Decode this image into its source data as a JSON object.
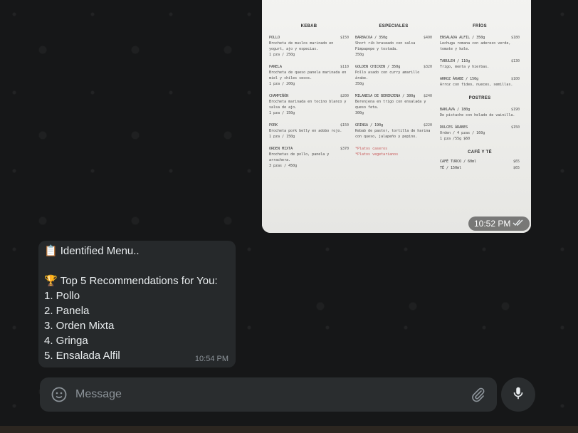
{
  "menu_image": {
    "columns": [
      {
        "title": "KEBAB",
        "items": [
          {
            "name": "POLLO",
            "price": "$150",
            "desc": "Brocheta de muslos marinado en yogurt, ajo y especias.",
            "weight": "1 pza / 250g"
          },
          {
            "name": "PANELA",
            "price": "$110",
            "desc": "Brocheta de queso panela marinada en miel y chiles secos.",
            "weight": "1 pza / 200g"
          },
          {
            "name": "CHAMPIÑÓN",
            "price": "$200",
            "desc": "Brocheta marinada en tocino blanco y salsa de ajo.",
            "weight": "1 pza / 150g"
          },
          {
            "name": "PORK",
            "price": "$150",
            "desc": "Brocheta pork belly en adobo rojo.",
            "weight": "1 pza / 150g"
          },
          {
            "name": "ORDEN MIXTA",
            "price": "$370",
            "desc": "Brochetas de pollo, panela y arrachera.",
            "weight": "3 pzas / 450g"
          }
        ]
      },
      {
        "title": "ESPECIALES",
        "items": [
          {
            "name": "BARBACOA / 350g",
            "price": "$490",
            "desc": "Short rib braseado con salsa Pimpapepe y tostada.",
            "weight": "350g"
          },
          {
            "name": "GOLDEN CHICKEN / 350g",
            "price": "$320",
            "desc": "Pollo asado con curry amarillo árabe.",
            "weight": "350g"
          },
          {
            "name": "MILANESA DE BERENJENA / 300g",
            "price": "$240",
            "desc": "Berenjena en trigo con ensalada y queso feta.",
            "weight": "300g"
          },
          {
            "name": "GRINGA / 190g",
            "price": "$220",
            "desc": "Kebab de pastor, tortilla de harina con queso, jalapeño y pepino.",
            "weight": ""
          }
        ],
        "notes": [
          "*Platos caseros",
          "*Platos vegetarianos"
        ]
      },
      {
        "title": "FRÍOS",
        "items": [
          {
            "name": "ENSALADA ALFIL / 350g",
            "price": "$180",
            "desc": "Lechuga romana con aderezo verde, tomate y kale.",
            "weight": ""
          },
          {
            "name": "TABULEH / 110g",
            "price": "$130",
            "desc": "Trigo, menta y hierbas.",
            "weight": ""
          },
          {
            "name": "ARROZ ÁRABE / 150g",
            "price": "$100",
            "desc": "Arroz con fideo, nueces, semillas.",
            "weight": ""
          }
        ]
      },
      {
        "title": "POSTRES",
        "items": [
          {
            "name": "BAKLAVA / 180g",
            "price": "$190",
            "desc": "De pistache con helado de vainilla.",
            "weight": ""
          },
          {
            "name": "DULCES ÁRABES",
            "price": "$150",
            "desc": "Orden / 4 pzas / 160g",
            "weight": "1 pza /55g  $60"
          }
        ]
      },
      {
        "title": "CAFÉ Y TÉ",
        "items": [
          {
            "name": "CAFÉ TURCO / 60ml",
            "price": "$65",
            "desc": "",
            "weight": ""
          },
          {
            "name": "TÉ / 150ml",
            "price": "$65",
            "desc": "",
            "weight": ""
          }
        ]
      }
    ],
    "timestamp": "10:52 PM",
    "status_icon": "double-check-icon"
  },
  "reply": {
    "lines": [
      {
        "emoji": "📋",
        "text": "Identified Menu.."
      },
      {
        "emoji": "",
        "text": ""
      },
      {
        "emoji": "🏆",
        "text": "Top 5 Recommendations for You:"
      },
      {
        "emoji": "",
        "text": "1. Pollo"
      },
      {
        "emoji": "",
        "text": "2. Panela"
      },
      {
        "emoji": "",
        "text": "3. Orden Mixta"
      },
      {
        "emoji": "",
        "text": "4. Gringa"
      },
      {
        "emoji": "",
        "text": "5. Ensalada Alfil"
      }
    ],
    "timestamp": "10:54 PM"
  },
  "composer": {
    "placeholder": "Message",
    "value": "",
    "emoji_icon": "smiley-icon",
    "attach_icon": "paperclip-icon",
    "mic_icon": "microphone-icon"
  },
  "colors": {
    "wallpaper": "#161718",
    "bubble_incoming": "#26292b",
    "composer": "#2a2d2f",
    "text_primary": "#e9edef",
    "text_secondary": "#8c9399"
  }
}
